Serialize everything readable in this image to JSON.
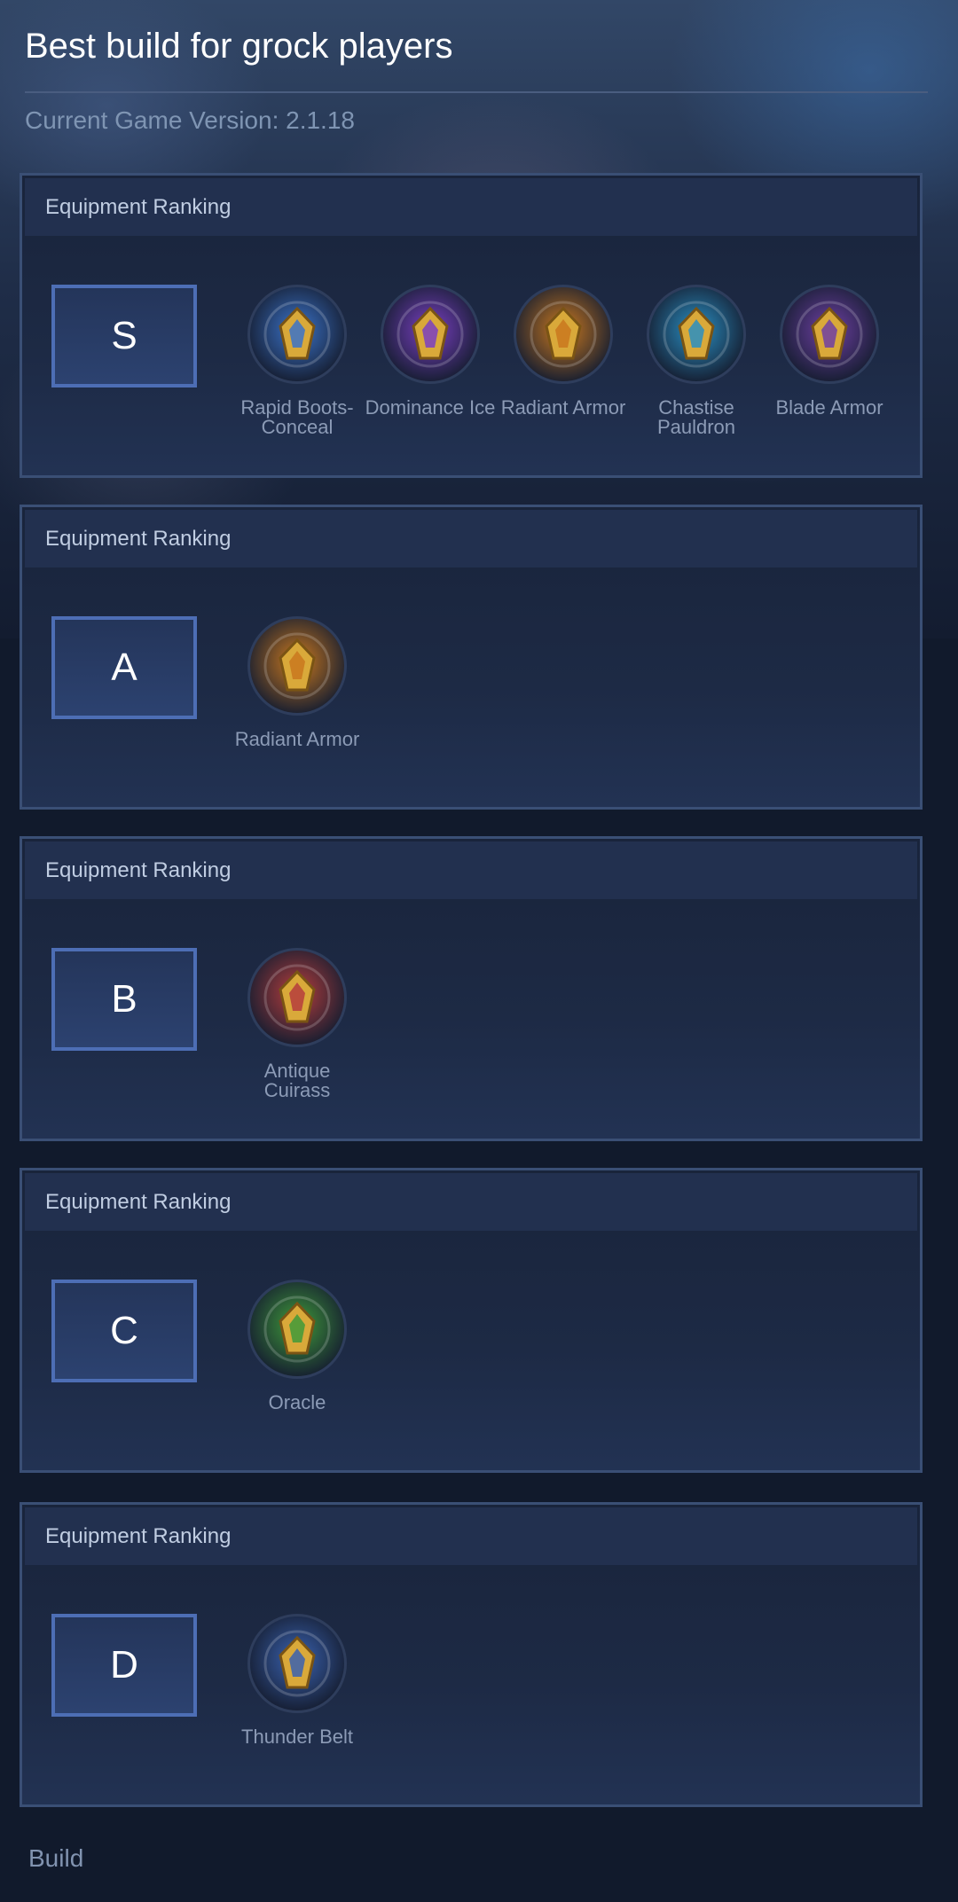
{
  "page": {
    "title": "Best build for grock players",
    "version": "Current Game Version: 2.1.18",
    "footer": "Build"
  },
  "tiers": [
    {
      "header": "Equipment Ranking",
      "tier": "S",
      "items": [
        {
          "name": "Rapid Boots-Conceal",
          "icon": "rapid-boots-icon",
          "color": "#3b73c9"
        },
        {
          "name": "Dominance Ice",
          "icon": "dominance-ice-icon",
          "color": "#7a3fc2"
        },
        {
          "name": "Radiant Armor",
          "icon": "radiant-armor-icon",
          "color": "#c9781f"
        },
        {
          "name": "Chastise Pauldron",
          "icon": "chastise-pauldron-icon",
          "color": "#2a8fc2"
        },
        {
          "name": "Blade Armor",
          "icon": "blade-armor-icon",
          "color": "#6e3fa3"
        }
      ]
    },
    {
      "header": "Equipment Ranking",
      "tier": "A",
      "items": [
        {
          "name": "Radiant Armor",
          "icon": "radiant-armor-icon",
          "color": "#c9781f"
        }
      ]
    },
    {
      "header": "Equipment Ranking",
      "tier": "B",
      "items": [
        {
          "name": "Antique Cuirass",
          "icon": "antique-cuirass-icon",
          "color": "#b53d3d"
        }
      ]
    },
    {
      "header": "Equipment Ranking",
      "tier": "C",
      "items": [
        {
          "name": "Oracle",
          "icon": "oracle-icon",
          "color": "#3f9a3a"
        }
      ]
    },
    {
      "header": "Equipment Ranking",
      "tier": "D",
      "items": [
        {
          "name": "Thunder Belt",
          "icon": "thunder-belt-icon",
          "color": "#3a62b0"
        }
      ]
    }
  ]
}
